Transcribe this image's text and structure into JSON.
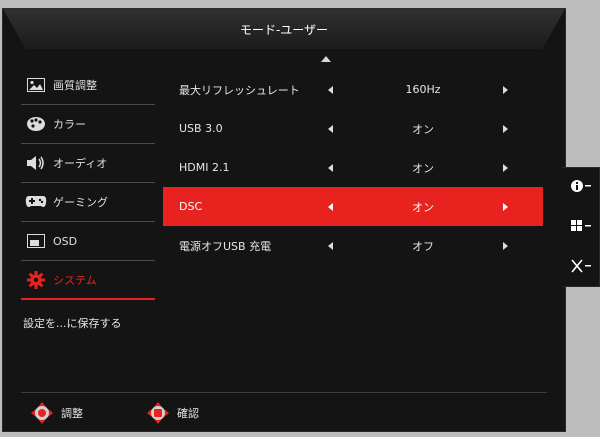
{
  "header": {
    "title": "モード-ユーザー"
  },
  "sidebar": {
    "items": [
      {
        "label": "画質調整",
        "icon": "picture-icon"
      },
      {
        "label": "カラー",
        "icon": "palette-icon"
      },
      {
        "label": "オーディオ",
        "icon": "speaker-icon"
      },
      {
        "label": "ゲーミング",
        "icon": "gamepad-icon"
      },
      {
        "label": "OSD",
        "icon": "osd-window-icon"
      },
      {
        "label": "システム",
        "icon": "gear-icon",
        "active": true
      }
    ],
    "save_label": "設定を...に保存する"
  },
  "settings": [
    {
      "label": "最大リフレッシュレート",
      "value": "160Hz"
    },
    {
      "label": "USB 3.0",
      "value": "オン"
    },
    {
      "label": "HDMI 2.1",
      "value": "オン"
    },
    {
      "label": "DSC",
      "value": "オン",
      "selected": true
    },
    {
      "label": "電源オフUSB 充電",
      "value": "オフ"
    }
  ],
  "footer": {
    "adjust_label": "調整",
    "confirm_label": "確認"
  },
  "keys": [
    {
      "icon": "info-icon"
    },
    {
      "icon": "input-grid-icon"
    },
    {
      "icon": "close-icon"
    }
  ],
  "colors": {
    "accent": "#e8231f",
    "background": "#141414"
  }
}
